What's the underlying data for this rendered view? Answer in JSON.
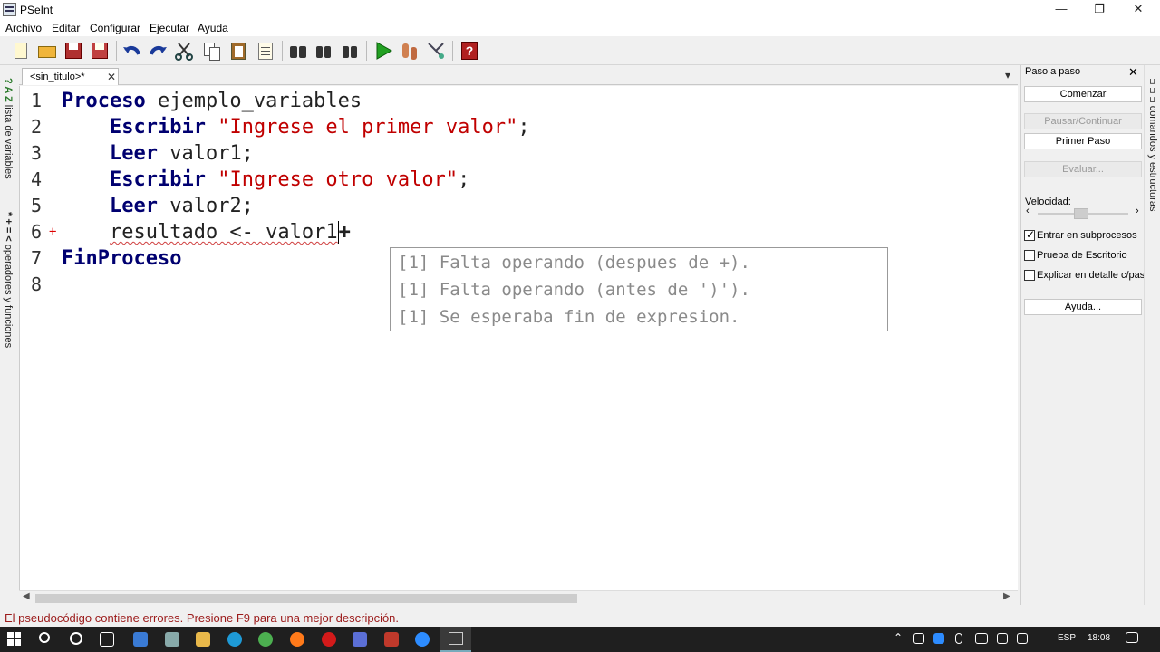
{
  "window": {
    "title": "PSeInt",
    "min": "—",
    "restore": "❐",
    "close": "✕"
  },
  "menu": [
    "Archivo",
    "Editar",
    "Configurar",
    "Ejecutar",
    "Ayuda"
  ],
  "left_strip": {
    "variables": "lista de variables",
    "operators": "operadores y funciones"
  },
  "tab": {
    "label": "<sin_titulo>*",
    "close": "✕",
    "dropdown": "▾"
  },
  "editor": {
    "lines": [
      {
        "n": "1",
        "kw": "Proceso",
        "rest": " ejemplo_variables"
      },
      {
        "n": "2",
        "indent": "    ",
        "kw": "Escribir",
        "sp": " ",
        "str": "\"Ingrese el primer valor\"",
        "end": ";"
      },
      {
        "n": "3",
        "indent": "    ",
        "kw": "Leer",
        "rest": " valor1;"
      },
      {
        "n": "4",
        "indent": "    ",
        "kw": "Escribir",
        "sp": " ",
        "str": "\"Ingrese otro valor\"",
        "end": ";"
      },
      {
        "n": "5",
        "indent": "    ",
        "kw": "Leer",
        "rest": " valor2;"
      },
      {
        "n": "6",
        "marker": "+",
        "indent": "    ",
        "err": "resultado <- valor1",
        "op": "+"
      },
      {
        "n": "7",
        "kw": "FinProceso"
      },
      {
        "n": "8"
      }
    ]
  },
  "tooltip": [
    "[1] Falta operando (despues de +).",
    "[1] Falta operando (antes de ')').",
    "[1] Se esperaba fin de expresion."
  ],
  "panel": {
    "title": "Paso a paso",
    "close": "✕",
    "btn_start": "Comenzar",
    "btn_pause": "Pausar/Continuar",
    "btn_first": "Primer Paso",
    "btn_eval": "Evaluar...",
    "speed_label": "Velocidad:",
    "chk_sub": "Entrar en subprocesos",
    "chk_sub_checked": true,
    "chk_desk": "Prueba de Escritorio",
    "chk_desk_checked": false,
    "chk_detail": "Explicar en detalle c/paso",
    "chk_detail_checked": false,
    "btn_help": "Ayuda..."
  },
  "right_strip": {
    "label": "comandos y estructuras"
  },
  "status": "El pseudocódigo contiene errores. Presione F9 para una mejor descripción.",
  "taskbar": {
    "lang": "ESP",
    "time": "18:08"
  },
  "colors": {
    "keyword": "#000070",
    "string": "#c00000",
    "status_text": "#9b1a1a"
  }
}
